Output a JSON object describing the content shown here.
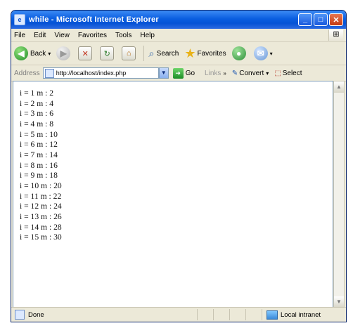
{
  "window": {
    "title": "while - Microsoft Internet Explorer",
    "app_icon": "ie-icon"
  },
  "menubar": {
    "items": [
      "File",
      "Edit",
      "View",
      "Favorites",
      "Tools",
      "Help"
    ]
  },
  "toolbar": {
    "back_label": "Back",
    "search_label": "Search",
    "favorites_label": "Favorites"
  },
  "addressbar": {
    "label": "Address",
    "url": "http://localhost/index.php",
    "go_label": "Go",
    "links_label": "Links",
    "convert_label": "Convert",
    "select_label": "Select"
  },
  "content": {
    "lines": [
      "i = 1 m : 2",
      "i = 2 m : 4",
      "i = 3 m : 6",
      "i = 4 m : 8",
      "i = 5 m : 10",
      "i = 6 m : 12",
      "i = 7 m : 14",
      "i = 8 m : 16",
      "i = 9 m : 18",
      "i = 10 m : 20",
      "i = 11 m : 22",
      "i = 12 m : 24",
      "i = 13 m : 26",
      "i = 14 m : 28",
      "i = 15 m : 30"
    ]
  },
  "statusbar": {
    "status_text": "Done",
    "zone_text": "Local intranet"
  },
  "colors": {
    "titlebar": "#0a5ee0",
    "chrome": "#ece9d8"
  }
}
